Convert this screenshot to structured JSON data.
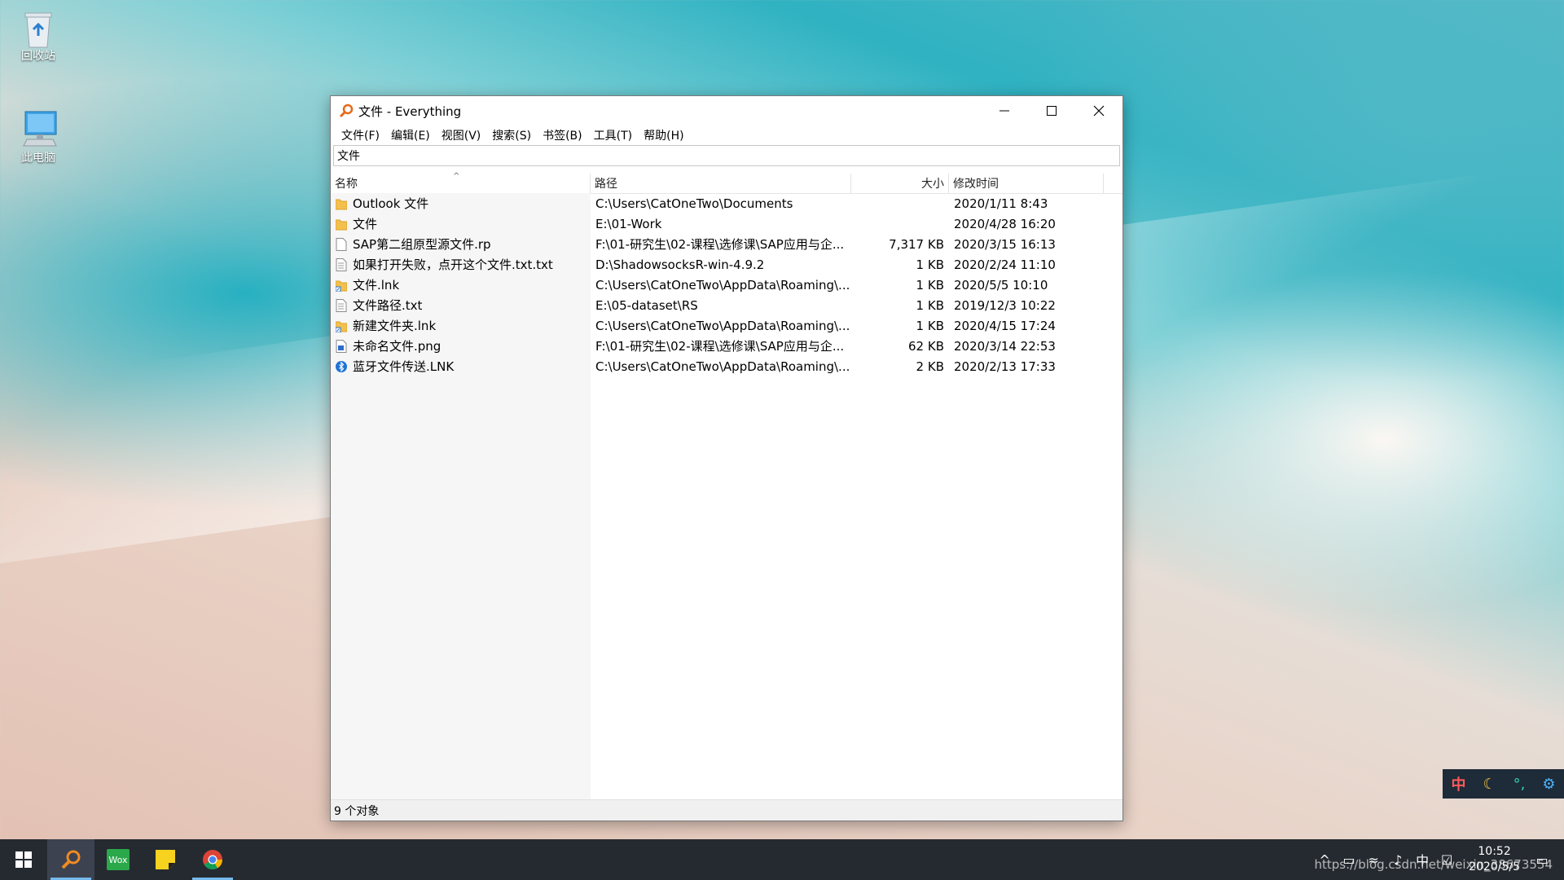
{
  "desktop": {
    "icons": [
      {
        "label": "回收站",
        "icon": "recycle-bin-icon"
      },
      {
        "label": "此电脑",
        "icon": "computer-icon"
      }
    ]
  },
  "window": {
    "title": "文件 - Everything",
    "menu": [
      "文件(F)",
      "编辑(E)",
      "视图(V)",
      "搜索(S)",
      "书签(B)",
      "工具(T)",
      "帮助(H)"
    ],
    "search_value": "文件",
    "columns": {
      "name": "名称",
      "path": "路径",
      "size": "大小",
      "modified": "修改时间"
    },
    "rows": [
      {
        "name": "Outlook 文件",
        "path": "C:\\Users\\CatOneTwo\\Documents",
        "size": "",
        "modified": "2020/1/11 8:43",
        "icon": "folder-icon"
      },
      {
        "name": "文件",
        "path": "E:\\01-Work",
        "size": "",
        "modified": "2020/4/28 16:20",
        "icon": "folder-icon"
      },
      {
        "name": "SAP第二组原型源文件.rp",
        "path": "F:\\01-研究生\\02-课程\\选修课\\SAP应用与企...",
        "size": "7,317 KB",
        "modified": "2020/3/15 16:13",
        "icon": "file-icon"
      },
      {
        "name": "如果打开失败，点开这个文件.txt.txt",
        "path": "D:\\ShadowsocksR-win-4.9.2",
        "size": "1 KB",
        "modified": "2020/2/24 11:10",
        "icon": "text-file-icon"
      },
      {
        "name": "文件.lnk",
        "path": "C:\\Users\\CatOneTwo\\AppData\\Roaming\\...",
        "size": "1 KB",
        "modified": "2020/5/5 10:10",
        "icon": "shortcut-icon"
      },
      {
        "name": "文件路径.txt",
        "path": "E:\\05-dataset\\RS",
        "size": "1 KB",
        "modified": "2019/12/3 10:22",
        "icon": "text-file-icon"
      },
      {
        "name": "新建文件夹.lnk",
        "path": "C:\\Users\\CatOneTwo\\AppData\\Roaming\\...",
        "size": "1 KB",
        "modified": "2020/4/15 17:24",
        "icon": "shortcut-icon"
      },
      {
        "name": "未命名文件.png",
        "path": "F:\\01-研究生\\02-课程\\选修课\\SAP应用与企...",
        "size": "62 KB",
        "modified": "2020/3/14 22:53",
        "icon": "image-file-icon"
      },
      {
        "name": "蓝牙文件传送.LNK",
        "path": "C:\\Users\\CatOneTwo\\AppData\\Roaming\\...",
        "size": "2 KB",
        "modified": "2020/2/13 17:33",
        "icon": "bluetooth-icon"
      }
    ],
    "status": "9 个对象"
  },
  "ime": {
    "mode": "中"
  },
  "taskbar": {
    "apps": [
      "start-icon",
      "everything-icon",
      "wox-icon",
      "sticky-notes-icon",
      "chrome-icon"
    ],
    "wox_label": "Wox",
    "time": "10:52",
    "date": "2020/5/5",
    "watermark": "https://blog.csdn.net/weixin_38673554"
  },
  "colors": {
    "taskbar": "#252a30",
    "accent": "#76b9ed",
    "ime_bg": "#1e2b38"
  }
}
